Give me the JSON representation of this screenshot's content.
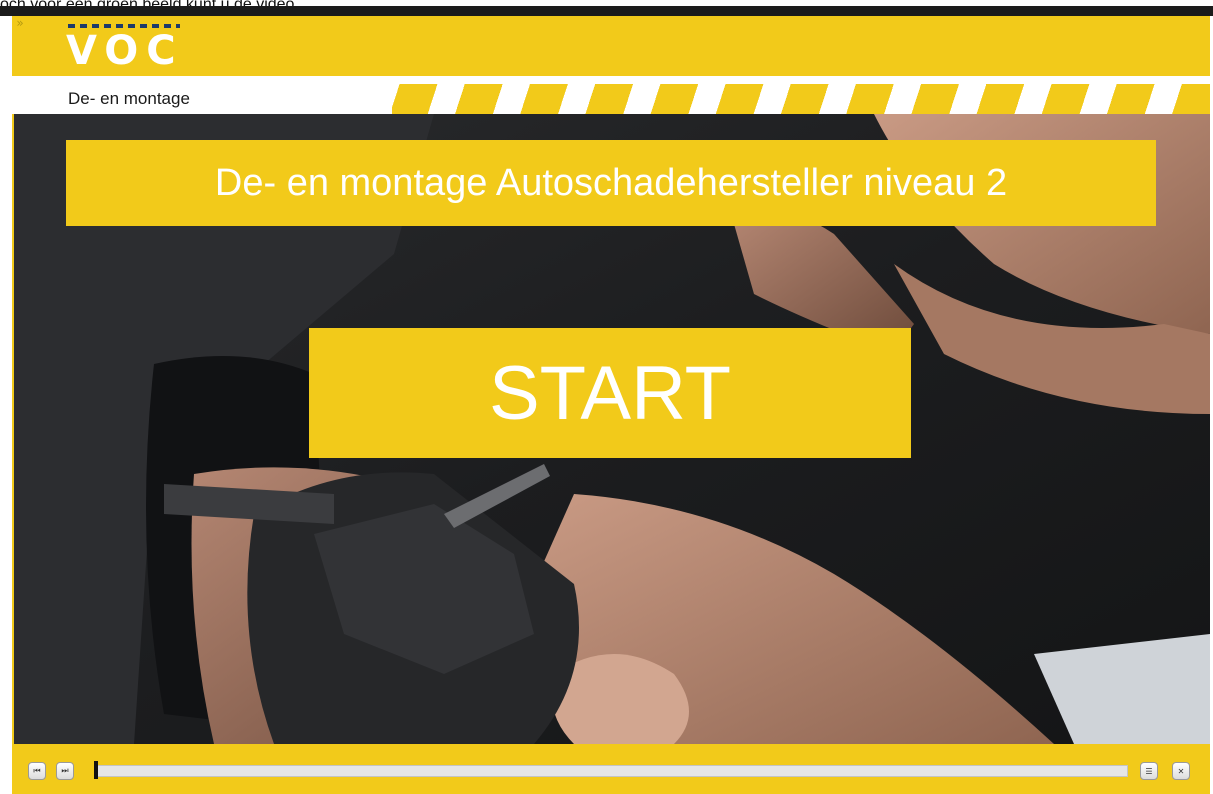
{
  "browser": {
    "strip_text": "och voor een groen beeld kunt u de video"
  },
  "header": {
    "expand_icon": "double-chevron-right-icon",
    "logo_text": "VOC",
    "brand_color": "#f2ca1a",
    "logo_accent_color": "#1d3a6a"
  },
  "subheader": {
    "title": "De- en montage"
  },
  "video": {
    "banner_title": "De- en montage Autoschadehersteller niveau 2",
    "start_label": "START"
  },
  "controls": {
    "prev_icon": "skip-back-icon",
    "next_icon": "skip-forward-icon",
    "menu_icon": "menu-icon",
    "close_icon": "close-icon",
    "progress": 0
  }
}
